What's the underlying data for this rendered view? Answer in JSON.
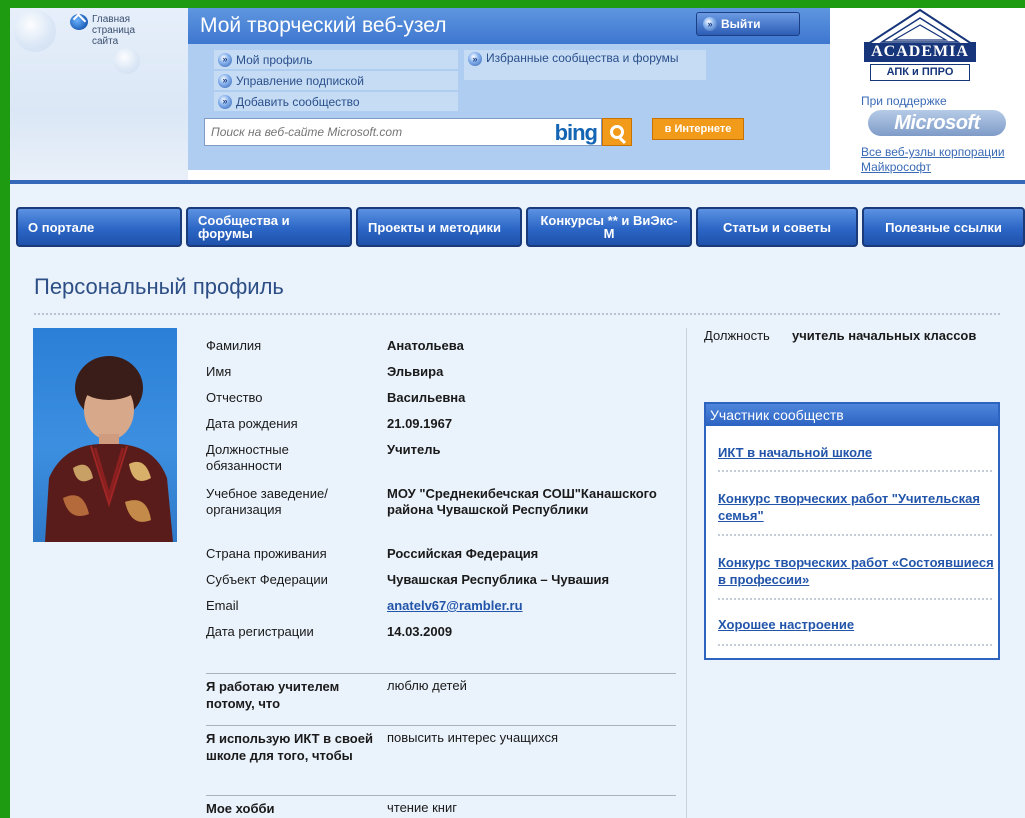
{
  "header": {
    "home_label": "Главная страница сайта",
    "site_title": "Мой творческий веб-узел",
    "logout_label": "Выйти",
    "menu_left": [
      "Мой профиль",
      "Управление подпиской",
      "Добавить сообщество"
    ],
    "menu_right": [
      "Избранные сообщества и форумы"
    ],
    "search_placeholder": "Поиск на веб-сайте Microsoft.com",
    "search_engine": "bing",
    "internet_button": "в Интернете",
    "academia_logo": "ACADEMIA",
    "apk_logo": "АПК и ППРО",
    "support_text": "При поддержке",
    "microsoft_logo": "Microsoft",
    "ms_sites_link": "Все веб-узлы корпорации Майкрософт"
  },
  "nav": {
    "tabs": [
      "О портале",
      "Сообщества и форумы",
      "Проекты и методики",
      "Конкурсы ** и ВиЭкс-М",
      "Статьи и советы",
      "Полезные ссылки"
    ]
  },
  "profile": {
    "page_title": "Персональный профиль",
    "fields": [
      {
        "label": "Фамилия",
        "value": "Анатольева"
      },
      {
        "label": "Имя",
        "value": "Эльвира"
      },
      {
        "label": "Отчество",
        "value": "Васильевна"
      },
      {
        "label": "Дата рождения",
        "value": "21.09.1967"
      },
      {
        "label": "Должностные обязанности",
        "value": "Учитель"
      },
      {
        "label": "Учебное заведение/организация",
        "value": "МОУ \"Среднекибечская СОШ\"Канашского района Чувашской Республики"
      },
      {
        "label": "Страна проживания",
        "value": "Российская Федерация"
      },
      {
        "label": "Субъект Федерации",
        "value": "Чувашская Республика – Чувашия"
      },
      {
        "label": "Email",
        "value": "anatelv67@rambler.ru"
      },
      {
        "label": "Дата регистрации",
        "value": "14.03.2009"
      }
    ],
    "qa": [
      {
        "question": "Я работаю учителем потому, что",
        "answer": "люблю детей"
      },
      {
        "question": "Я использую ИКТ в своей школе для того, чтобы",
        "answer": "повысить интерес учащихся"
      },
      {
        "question": "Мое хобби",
        "answer": "чтение книг"
      }
    ],
    "position_label": "Должность",
    "position_value": "учитель начальных классов"
  },
  "communities": {
    "title": "Участник сообществ",
    "items": [
      "ИКТ в начальной школе",
      "Конкурс творческих работ \"Учительская семья\"",
      "Конкурс творческих работ «Состоявшиеся в профессии»",
      "Хорошее настроение"
    ]
  },
  "colors": {
    "page_border": "#1f9b12",
    "header_blue": "#3d77cf",
    "link_blue": "#2255aa",
    "accent_orange": "#f29a1a"
  }
}
